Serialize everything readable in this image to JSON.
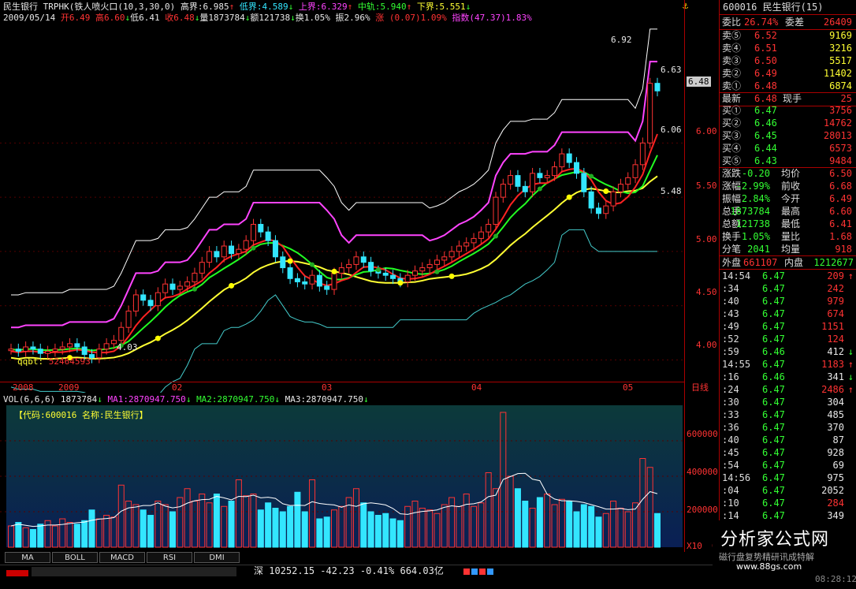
{
  "header": {
    "stock_name": "民生银行",
    "indicator": "TRPHK(铁人喷火口(10,3,30,0)",
    "high_bound_label": "高界:",
    "high_bound": "6.985",
    "low_bound_label": "低界:",
    "low_bound": "4.589",
    "upper_label": "上界:",
    "upper": "6.329",
    "mid_label": "中轨:",
    "mid": "5.940",
    "lower_label": "下界:",
    "lower": "5.551",
    "date": "2009/05/14",
    "open": "开6.49",
    "high": "高6.60",
    "low": "低6.41",
    "close": "收6.48",
    "volume": "量1873784",
    "amount": "额121738",
    "turnover": "换1.05%",
    "amplitude": "振2.96%",
    "change": "涨 (0.07)1.09%",
    "index": "指数(47.37)1.83%"
  },
  "main_chart": {
    "annotations": {
      "peak": "6.92",
      "p1": "6.63",
      "p2": "6.06",
      "p3": "5.48",
      "low": "4.03",
      "qqbt_label": "qqbt:",
      "qqbt_value": "52464593"
    },
    "price_levels": [
      "6.48",
      "6.00",
      "5.50",
      "5.00",
      "4.50",
      "4.00"
    ],
    "x_labels": [
      "2008",
      "2009",
      "02",
      "03",
      "04",
      "05"
    ],
    "period_label": "日线"
  },
  "volume_chart": {
    "header": "VOL(6,6,6)",
    "vol": "1873784",
    "ma1": "MA1:2870947.750",
    "ma2": "MA2:2870947.750",
    "ma3": "MA3:2870947.750",
    "info": "【代码:600016 名称:民生银行】",
    "scale": [
      "600000",
      "400000",
      "200000"
    ],
    "unit": "X10",
    "zero": "0"
  },
  "chart_data": {
    "type": "candlestick",
    "x_labels": [
      "2008",
      "2009",
      "02",
      "03",
      "04",
      "05"
    ],
    "y_ticks": [
      4.0,
      4.5,
      5.0,
      5.5,
      6.0
    ],
    "ylim": [
      3.8,
      7.1
    ],
    "volume_ylim": [
      0,
      800000
    ],
    "volume_ticks": [
      200000,
      400000,
      600000
    ],
    "closes": [
      4.1,
      4.08,
      4.12,
      4.1,
      4.06,
      4.08,
      4.1,
      4.12,
      4.15,
      4.12,
      4.05,
      4.02,
      4.1,
      4.15,
      4.18,
      4.3,
      4.45,
      4.6,
      4.55,
      4.5,
      4.62,
      4.7,
      4.65,
      4.68,
      4.72,
      4.8,
      4.9,
      5.0,
      4.95,
      5.05,
      4.98,
      5.02,
      5.1,
      5.25,
      5.18,
      5.1,
      4.95,
      4.85,
      4.75,
      4.72,
      4.7,
      4.78,
      4.68,
      4.65,
      4.8,
      4.85,
      4.88,
      4.95,
      4.9,
      4.82,
      4.8,
      4.78,
      4.75,
      4.72,
      4.78,
      4.82,
      4.85,
      4.88,
      4.92,
      4.95,
      5.0,
      5.05,
      5.08,
      5.12,
      5.18,
      5.25,
      5.5,
      5.62,
      5.7,
      5.6,
      5.55,
      5.72,
      5.68,
      5.7,
      5.78,
      5.9,
      5.82,
      5.72,
      5.55,
      5.4,
      5.35,
      5.42,
      5.55,
      5.62,
      5.68,
      5.8,
      6.0,
      6.55,
      6.48
    ],
    "volumes": [
      120000,
      140000,
      110000,
      100000,
      130000,
      150000,
      120000,
      160000,
      140000,
      130000,
      150000,
      210000,
      160000,
      180000,
      170000,
      350000,
      260000,
      240000,
      210000,
      180000,
      260000,
      240000,
      200000,
      280000,
      330000,
      260000,
      300000,
      250000,
      300000,
      230000,
      260000,
      380000,
      290000,
      300000,
      210000,
      250000,
      220000,
      200000,
      230000,
      310000,
      200000,
      380000,
      160000,
      170000,
      210000,
      230000,
      280000,
      330000,
      250000,
      200000,
      180000,
      190000,
      160000,
      150000,
      230000,
      260000,
      220000,
      210000,
      190000,
      240000,
      280000,
      230000,
      300000,
      230000,
      250000,
      420000,
      330000,
      760000,
      400000,
      330000,
      260000,
      220000,
      280000,
      300000,
      240000,
      270000,
      260000,
      200000,
      240000,
      230000,
      170000,
      190000,
      260000,
      220000,
      200000,
      250000,
      500000,
      450000,
      190000
    ]
  },
  "quote": {
    "code_title": "600016 民生银行(15)",
    "wb_label": "委比",
    "wb": "26.74%",
    "wc_label": "委差",
    "wc": "26409",
    "sells": [
      {
        "label": "卖⑤",
        "price": "6.52",
        "vol": "9169"
      },
      {
        "label": "卖④",
        "price": "6.51",
        "vol": "3216"
      },
      {
        "label": "卖③",
        "price": "6.50",
        "vol": "5517"
      },
      {
        "label": "卖②",
        "price": "6.49",
        "vol": "11402"
      },
      {
        "label": "卖①",
        "price": "6.48",
        "vol": "6874"
      }
    ],
    "latest_label": "最新",
    "latest": "6.48",
    "hand_label": "现手",
    "hand": "25",
    "buys": [
      {
        "label": "买①",
        "price": "6.47",
        "vol": "3756"
      },
      {
        "label": "买②",
        "price": "6.46",
        "vol": "14762"
      },
      {
        "label": "买③",
        "price": "6.45",
        "vol": "28013"
      },
      {
        "label": "买④",
        "price": "6.44",
        "vol": "6573"
      },
      {
        "label": "买⑤",
        "price": "6.43",
        "vol": "9484"
      }
    ],
    "stats": [
      {
        "l1": "涨跌",
        "v1": "-0.20",
        "l2": "均价",
        "v2": "6.50"
      },
      {
        "l1": "涨幅",
        "v1": "-2.99%",
        "l2": "前收",
        "v2": "6.68"
      },
      {
        "l1": "振幅",
        "v1": "2.84%",
        "l2": "今开",
        "v2": "6.49"
      },
      {
        "l1": "总手",
        "v1": "1873784",
        "l2": "最高",
        "v2": "6.60"
      },
      {
        "l1": "总额",
        "v1": "121738",
        "l2": "最低",
        "v2": "6.41"
      },
      {
        "l1": "换手",
        "v1": "1.05%",
        "l2": "量比",
        "v2": "1.68"
      },
      {
        "l1": "分笔",
        "v1": "2041",
        "l2": "均量",
        "v2": "918"
      }
    ],
    "outer_label": "外盘",
    "outer": "661107",
    "inner_label": "内盘",
    "inner": "1212677",
    "ticks": [
      {
        "time": "14:54",
        "price": "6.47",
        "vol": "209",
        "dir": "↑",
        "c": "red"
      },
      {
        "time": ":34",
        "price": "6.47",
        "vol": "242",
        "dir": "",
        "c": "red"
      },
      {
        "time": ":40",
        "price": "6.47",
        "vol": "979",
        "dir": "",
        "c": "red"
      },
      {
        "time": ":43",
        "price": "6.47",
        "vol": "674",
        "dir": "",
        "c": "red"
      },
      {
        "time": ":49",
        "price": "6.47",
        "vol": "1151",
        "dir": "",
        "c": "red"
      },
      {
        "time": ":52",
        "price": "6.47",
        "vol": "124",
        "dir": "",
        "c": "red"
      },
      {
        "time": ":59",
        "price": "6.46",
        "vol": "412",
        "dir": "↓",
        "c": "white"
      },
      {
        "time": "14:55",
        "price": "6.47",
        "vol": "1183",
        "dir": "↑",
        "c": "red"
      },
      {
        "time": ":16",
        "price": "6.46",
        "vol": "341",
        "dir": "↓",
        "c": "white"
      },
      {
        "time": ":24",
        "price": "6.47",
        "vol": "2486",
        "dir": "↑",
        "c": "red"
      },
      {
        "time": ":30",
        "price": "6.47",
        "vol": "304",
        "dir": "",
        "c": "white"
      },
      {
        "time": ":33",
        "price": "6.47",
        "vol": "485",
        "dir": "",
        "c": "white"
      },
      {
        "time": ":36",
        "price": "6.47",
        "vol": "370",
        "dir": "",
        "c": "white"
      },
      {
        "time": ":40",
        "price": "6.47",
        "vol": "87",
        "dir": "",
        "c": "white"
      },
      {
        "time": ":45",
        "price": "6.47",
        "vol": "928",
        "dir": "",
        "c": "white"
      },
      {
        "time": ":54",
        "price": "6.47",
        "vol": "69",
        "dir": "",
        "c": "white"
      },
      {
        "time": "14:56",
        "price": "6.47",
        "vol": "975",
        "dir": "",
        "c": "white"
      },
      {
        "time": ":04",
        "price": "6.47",
        "vol": "2052",
        "dir": "",
        "c": "white"
      },
      {
        "time": ":10",
        "price": "6.47",
        "vol": "284",
        "dir": "",
        "c": "red"
      },
      {
        "time": ":14",
        "price": "6.47",
        "vol": "349",
        "dir": "",
        "c": "white"
      }
    ]
  },
  "tabs": [
    "MA",
    "BOLL",
    "MACD",
    "RSI",
    "DMI"
  ],
  "status": {
    "market": "深",
    "index": "10252.15",
    "change": "-42.23",
    "pct": "-0.41%",
    "amount": "664.03亿",
    "time": "08:28:12"
  },
  "watermark": {
    "title": "分析家公式网",
    "sub": "磁行盘复势精研讯成特解",
    "url": "www.88gs.com"
  },
  "colors": {
    "up": "#ff3333",
    "down": "#33e6ff",
    "ma_yellow": "#ffff33",
    "ma_red": "#ff2222",
    "ma_green": "#22ff22",
    "band": "#ff44ff"
  }
}
